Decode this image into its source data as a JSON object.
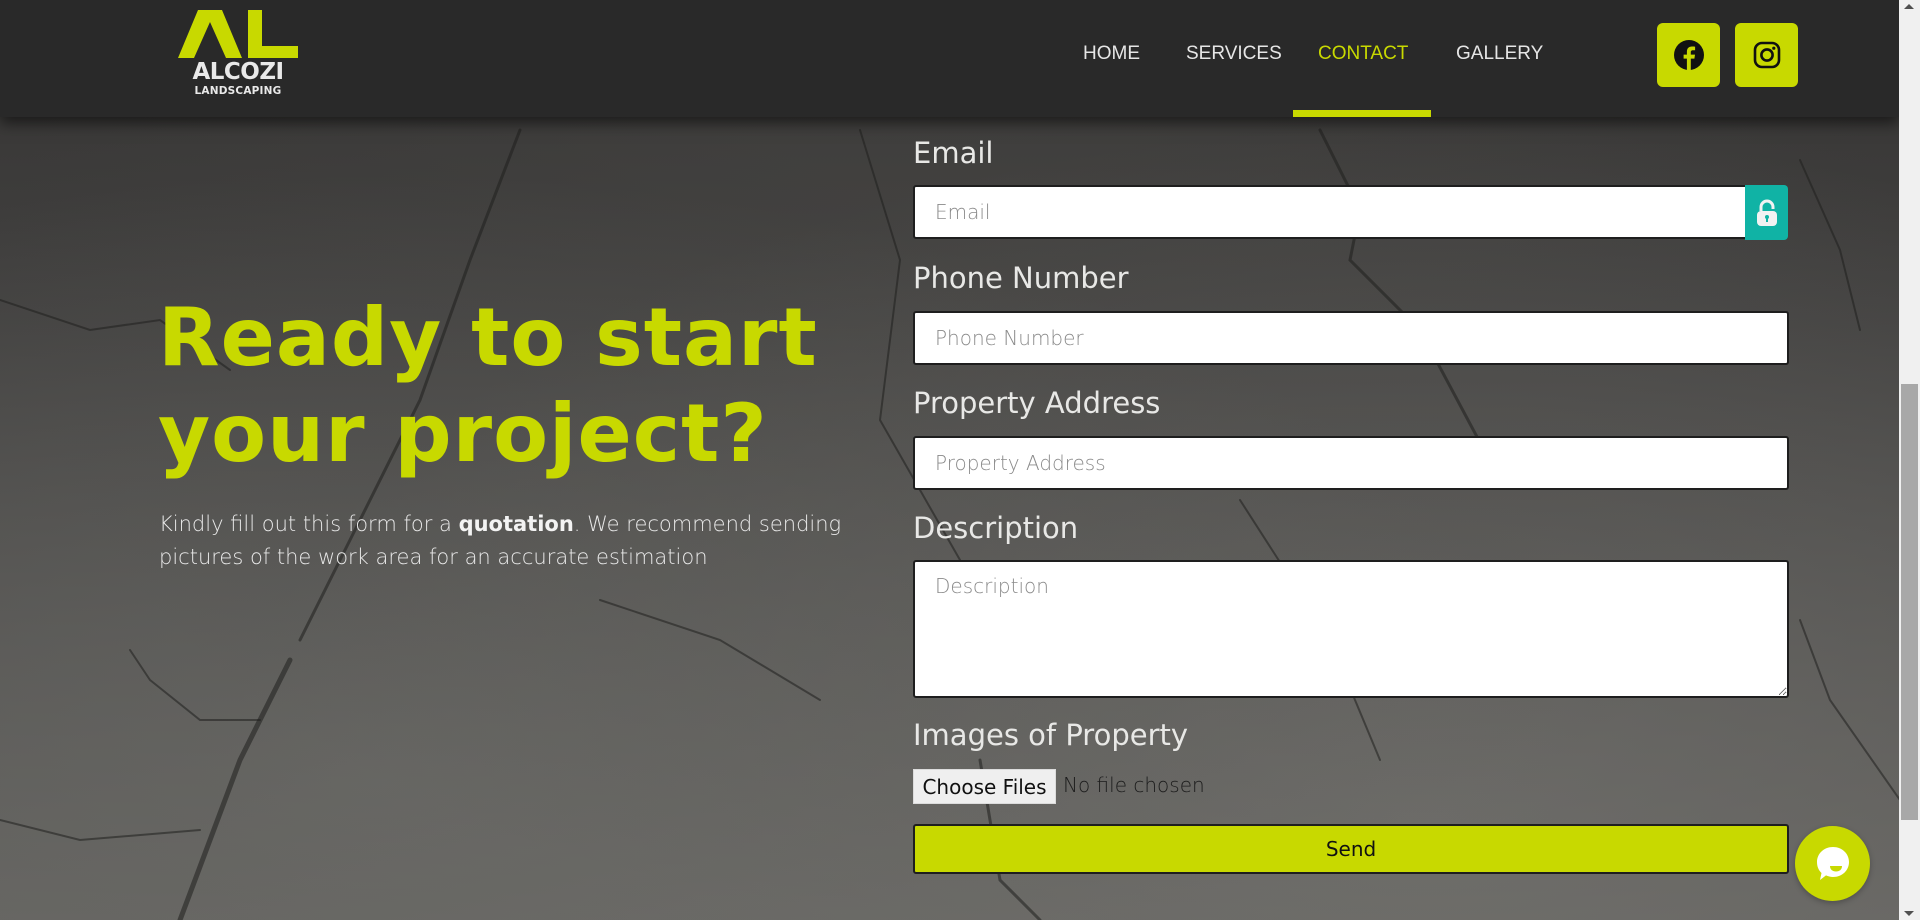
{
  "brand": {
    "mark": "AL",
    "name": "ALCOZI",
    "subtitle": "LANDSCAPING",
    "accent_color": "#c8d900"
  },
  "nav": {
    "items": [
      {
        "label": "HOME",
        "active": false
      },
      {
        "label": "SERVICES",
        "active": false
      },
      {
        "label": "CONTACT",
        "active": true
      },
      {
        "label": "GALLERY",
        "active": false
      }
    ]
  },
  "social": [
    {
      "icon": "facebook-icon",
      "label": "Facebook"
    },
    {
      "icon": "instagram-icon",
      "label": "Instagram"
    }
  ],
  "hero": {
    "title_line1": "Ready to start",
    "title_line2": "your project?",
    "text_part1": "Kindly fill out this form for a ",
    "text_bold": "quotation",
    "text_part2": ".  We recommend sending pictures of the work area for an accurate estimation"
  },
  "form": {
    "email": {
      "label": "Email",
      "placeholder": "Email",
      "value": ""
    },
    "phone": {
      "label": "Phone Number",
      "placeholder": "Phone Number",
      "value": ""
    },
    "address": {
      "label": "Property Address",
      "placeholder": "Property Address",
      "value": ""
    },
    "description": {
      "label": "Description",
      "placeholder": "Description",
      "value": ""
    },
    "images": {
      "label": "Images of Property",
      "button": "Choose Files",
      "status": "No file chosen"
    },
    "password_manager_icon": "lock-icon",
    "password_manager_color": "#10b3a5",
    "submit": "Send"
  },
  "chat": {
    "icon": "chat-bubble-icon"
  }
}
